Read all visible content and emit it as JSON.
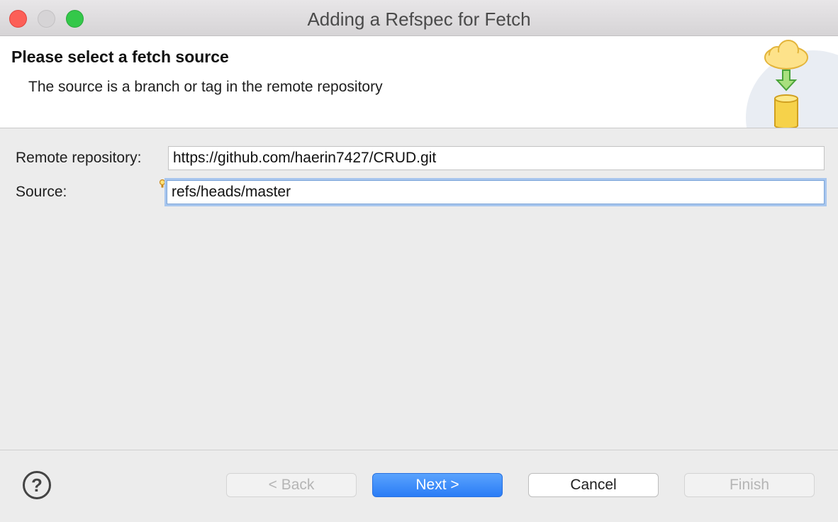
{
  "window": {
    "title": "Adding a Refspec for Fetch"
  },
  "banner": {
    "title": "Please select a fetch source",
    "description": "The source is a branch or tag in the remote repository",
    "icon": "cloud-to-database-fetch-icon"
  },
  "form": {
    "remote_label": "Remote repository:",
    "remote_value": "https://github.com/haerin7427/CRUD.git",
    "source_label": "Source:",
    "source_value": "refs/heads/master"
  },
  "footer": {
    "help_label": "?",
    "back_label": "< Back",
    "next_label": "Next >",
    "cancel_label": "Cancel",
    "finish_label": "Finish"
  },
  "colors": {
    "primary_button": "#2a7cf6",
    "focus_ring": "#a8c6ee",
    "close": "#fc5f57",
    "zoom": "#34c84a"
  }
}
